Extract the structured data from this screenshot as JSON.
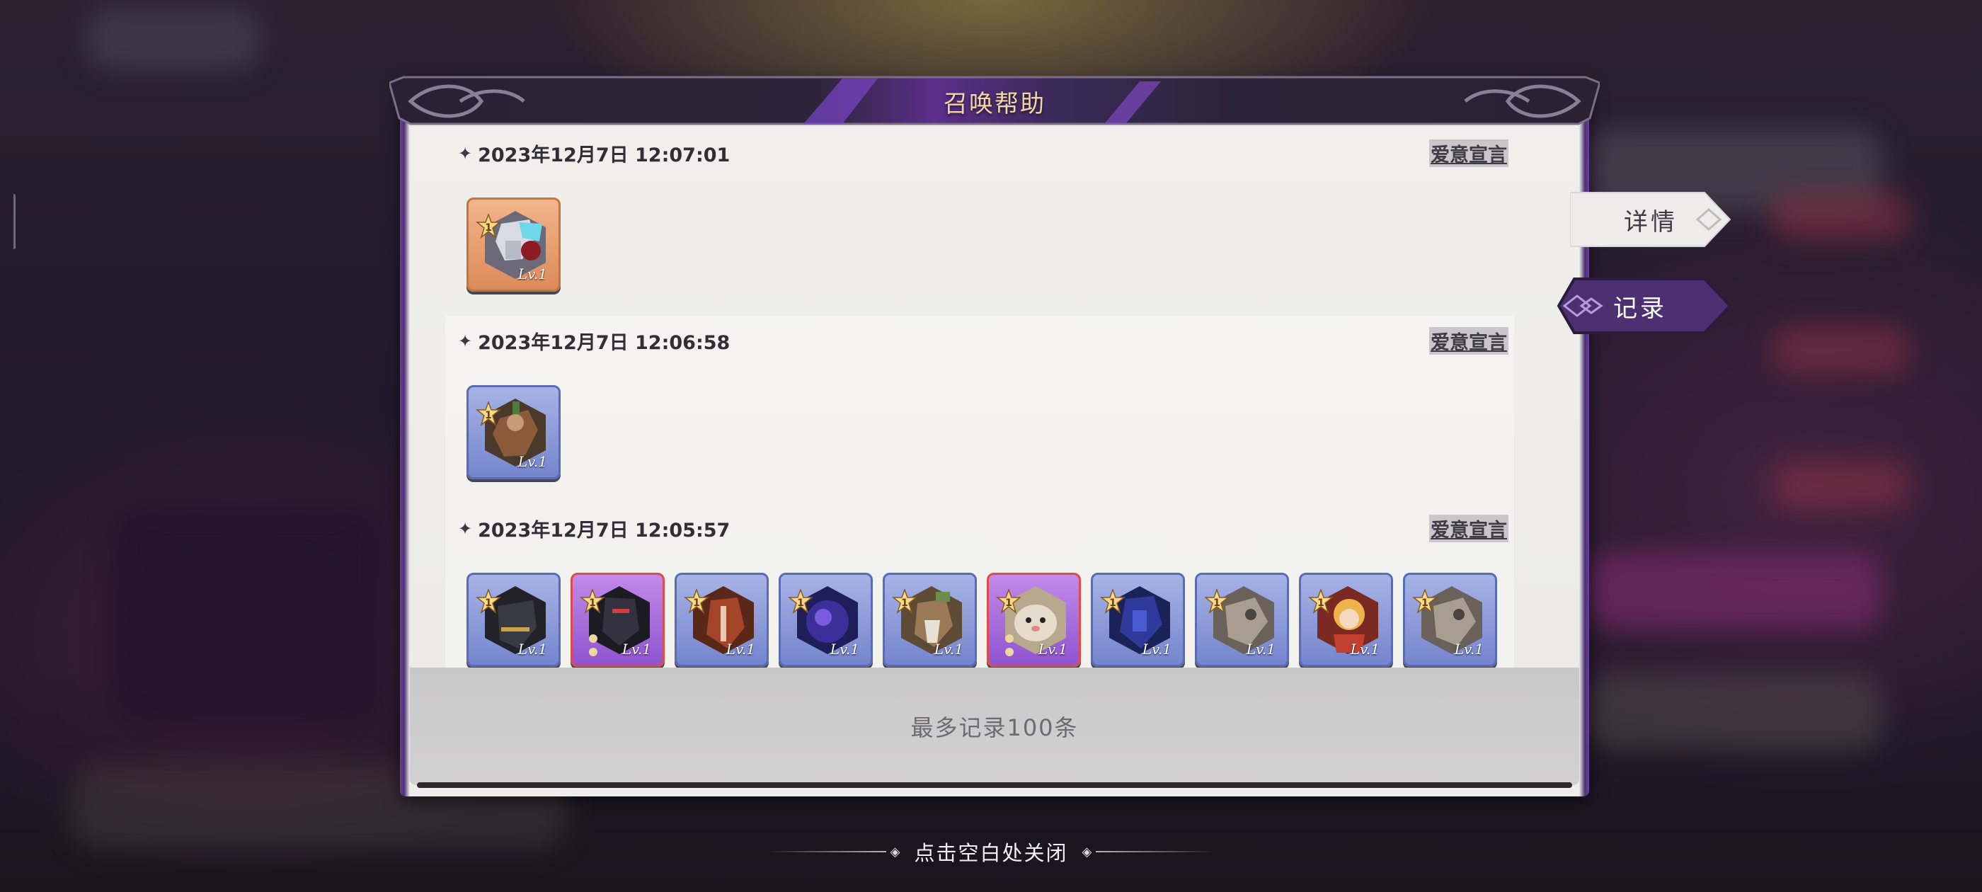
{
  "dialog": {
    "title": "召唤帮助",
    "footer_note": "最多记录100条"
  },
  "side_tabs": {
    "details": "详情",
    "records": "记录",
    "active": "records"
  },
  "records": [
    {
      "time": "2023年12月7日  12:07:01",
      "link": "爱意宣言",
      "cards": [
        {
          "level": "Lv.1",
          "rarity": "orange",
          "star": "1",
          "icon": "armored-knight-portrait"
        }
      ]
    },
    {
      "time": "2023年12月7日  12:06:58",
      "link": "爱意宣言",
      "cards": [
        {
          "level": "Lv.1",
          "rarity": "blue",
          "star": "1",
          "icon": "ranger-portrait"
        }
      ]
    },
    {
      "time": "2023年12月7日  12:05:57",
      "link": "爱意宣言",
      "cards": [
        {
          "level": "Lv.1",
          "rarity": "blue",
          "star": "1",
          "icon": "dark-knight-portrait"
        },
        {
          "level": "Lv.1",
          "rarity": "purple",
          "star": "1",
          "icon": "shadow-warrior-portrait"
        },
        {
          "level": "Lv.1",
          "rarity": "blue",
          "star": "1",
          "icon": "red-mage-portrait"
        },
        {
          "level": "Lv.1",
          "rarity": "blue",
          "star": "1",
          "icon": "void-orb-portrait"
        },
        {
          "level": "Lv.1",
          "rarity": "blue",
          "star": "1",
          "icon": "bearded-warrior-portrait"
        },
        {
          "level": "Lv.1",
          "rarity": "purple",
          "star": "1",
          "icon": "hamster-portrait"
        },
        {
          "level": "Lv.1",
          "rarity": "blue",
          "star": "1",
          "icon": "blue-golem-portrait"
        },
        {
          "level": "Lv.1",
          "rarity": "blue",
          "star": "1",
          "icon": "gray-beast-portrait"
        },
        {
          "level": "Lv.1",
          "rarity": "blue",
          "star": "1",
          "icon": "blonde-girl-portrait"
        },
        {
          "level": "Lv.1",
          "rarity": "blue",
          "star": "1",
          "icon": "gray-beast-portrait"
        }
      ]
    }
  ],
  "close_hint": "点击空白处关闭",
  "colors": {
    "accent_purple": "#6a3f9e",
    "title_gold": "#f1d6a2",
    "panel_bg": "#efedea"
  }
}
